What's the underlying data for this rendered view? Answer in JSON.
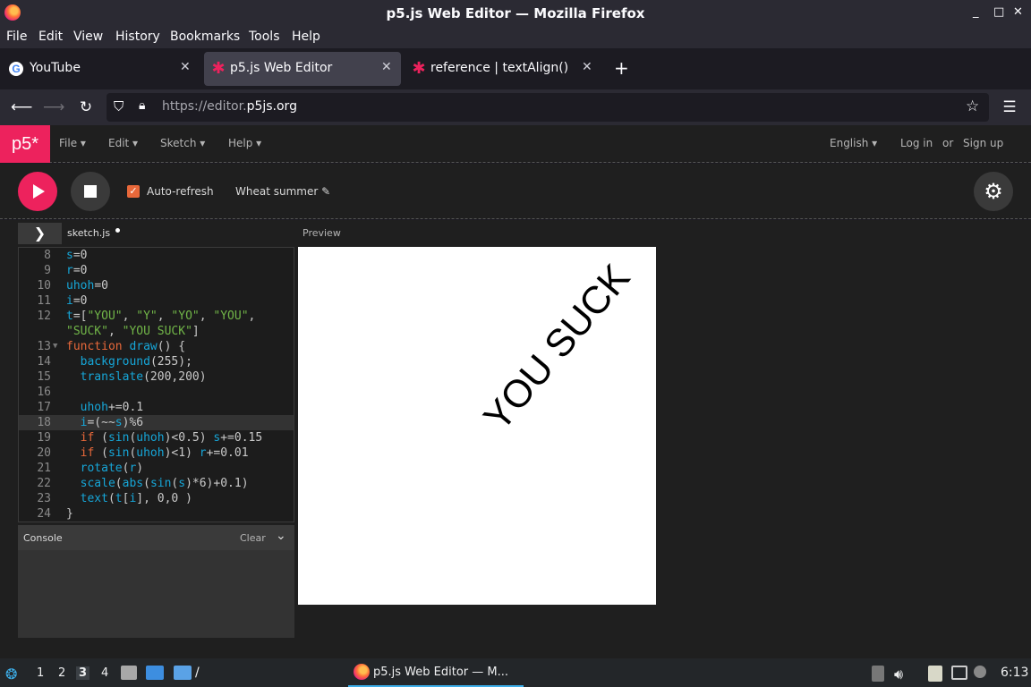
{
  "window": {
    "title": "p5.js Web Editor — Mozilla Firefox",
    "minimize": "_",
    "maximize": "□",
    "close": "✕"
  },
  "menubar": [
    "File",
    "Edit",
    "View",
    "History",
    "Bookmarks",
    "Tools",
    "Help"
  ],
  "tabs": [
    {
      "label": "YouTube",
      "favicon": "youtube-g-icon"
    },
    {
      "label": "p5.js Web Editor",
      "favicon": "p5-asterisk-icon",
      "active": true
    },
    {
      "label": "reference | textAlign()",
      "favicon": "p5-asterisk-icon"
    }
  ],
  "newtab": "+",
  "nav": {
    "url_prefix": "https://editor.",
    "url_domain": "p5js.org"
  },
  "p5": {
    "logo": "p5*",
    "menus": [
      "File ▾",
      "Edit ▾",
      "Sketch ▾",
      "Help ▾"
    ],
    "language": "English ▾",
    "login": "Log in",
    "or": "or",
    "signup": "Sign up",
    "autorefresh": "Auto-refresh",
    "sketch_name": "Wheat summer ✎",
    "file_tab": "sketch.js",
    "preview_label": "Preview",
    "console_title": "Console",
    "console_clear": "Clear"
  },
  "code_lines": [
    {
      "n": "8"
    },
    {
      "n": "9"
    },
    {
      "n": "10"
    },
    {
      "n": "11"
    },
    {
      "n": "12"
    },
    {
      "n": ""
    },
    {
      "n": "13"
    },
    {
      "n": "14"
    },
    {
      "n": "15"
    },
    {
      "n": "16"
    },
    {
      "n": "17"
    },
    {
      "n": "18"
    },
    {
      "n": "19"
    },
    {
      "n": "20"
    },
    {
      "n": "21"
    },
    {
      "n": "22"
    },
    {
      "n": "23"
    },
    {
      "n": "24"
    }
  ],
  "canvas_text": "YOU SUCK",
  "taskbar": {
    "workspaces": [
      "1",
      "2",
      "3",
      "4"
    ],
    "active_task": "p5.js Web Editor — M...",
    "clock": "6:13"
  },
  "colors": {
    "accent": "#ed225d",
    "checkbox": "#e8683a",
    "keyword": "#e8683a",
    "builtin": "#16a6d8",
    "string": "#71b548"
  }
}
